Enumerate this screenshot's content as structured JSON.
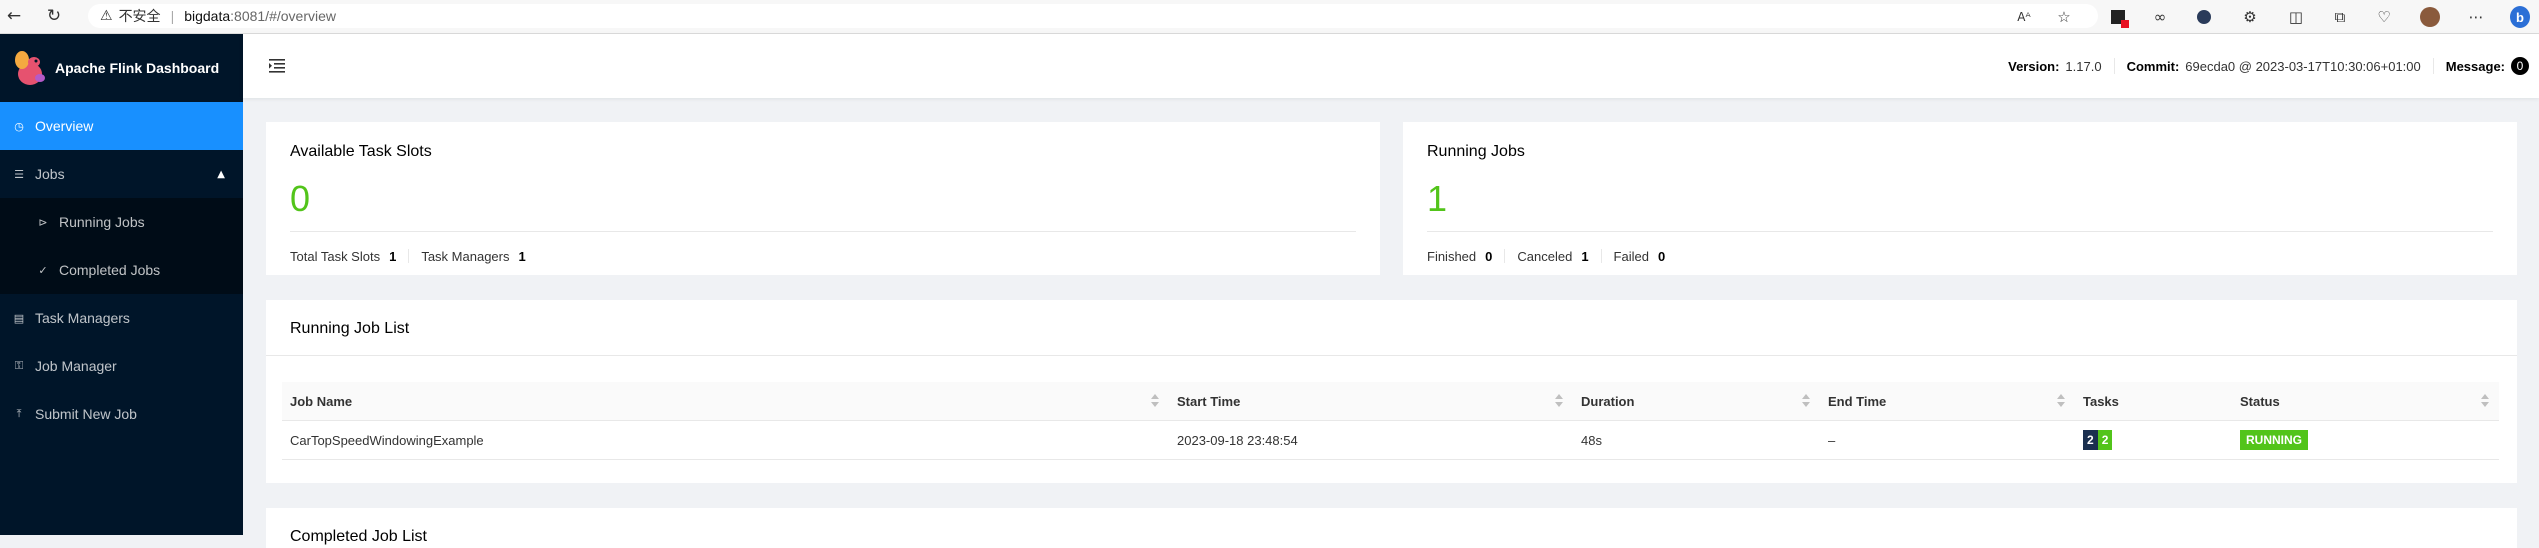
{
  "browser": {
    "insecure_label": "不安全",
    "url_host": "bigdata",
    "url_path": ":8081/#/overview"
  },
  "sidebar": {
    "app_title": "Apache Flink Dashboard",
    "items": [
      {
        "label": "Overview",
        "icon": "dashboard-icon"
      },
      {
        "label": "Jobs",
        "icon": "list-icon"
      },
      {
        "label": "Running Jobs",
        "icon": "play-circle-icon"
      },
      {
        "label": "Completed Jobs",
        "icon": "check-circle-icon"
      },
      {
        "label": "Task Managers",
        "icon": "schedule-icon"
      },
      {
        "label": "Job Manager",
        "icon": "build-icon"
      },
      {
        "label": "Submit New Job",
        "icon": "upload-icon"
      }
    ]
  },
  "header": {
    "version_label": "Version:",
    "version_value": "1.17.0",
    "commit_label": "Commit:",
    "commit_value": "69ecda0 @ 2023-03-17T10:30:06+01:00",
    "message_label": "Message:",
    "message_count": "0"
  },
  "slots_card": {
    "title": "Available Task Slots",
    "value": "0",
    "total_label": "Total Task Slots",
    "total_value": "1",
    "tm_label": "Task Managers",
    "tm_value": "1"
  },
  "jobs_card": {
    "title": "Running Jobs",
    "value": "1",
    "finished_label": "Finished",
    "finished_value": "0",
    "canceled_label": "Canceled",
    "canceled_value": "1",
    "failed_label": "Failed",
    "failed_value": "0"
  },
  "running_list": {
    "title": "Running Job List",
    "columns": [
      "Job Name",
      "Start Time",
      "Duration",
      "End Time",
      "Tasks",
      "Status"
    ],
    "rows": [
      {
        "job_name": "CarTopSpeedWindowingExample",
        "start_time": "2023-09-18 23:48:54",
        "duration": "48s",
        "end_time": "–",
        "tasks_a": "2",
        "tasks_b": "2",
        "status": "RUNNING"
      }
    ]
  },
  "completed_list": {
    "title": "Completed Job List"
  },
  "colors": {
    "sidebar_bg": "#001529",
    "active_item": "#1890ff",
    "green": "#52c41a",
    "task_dark": "#1a2f4f"
  }
}
